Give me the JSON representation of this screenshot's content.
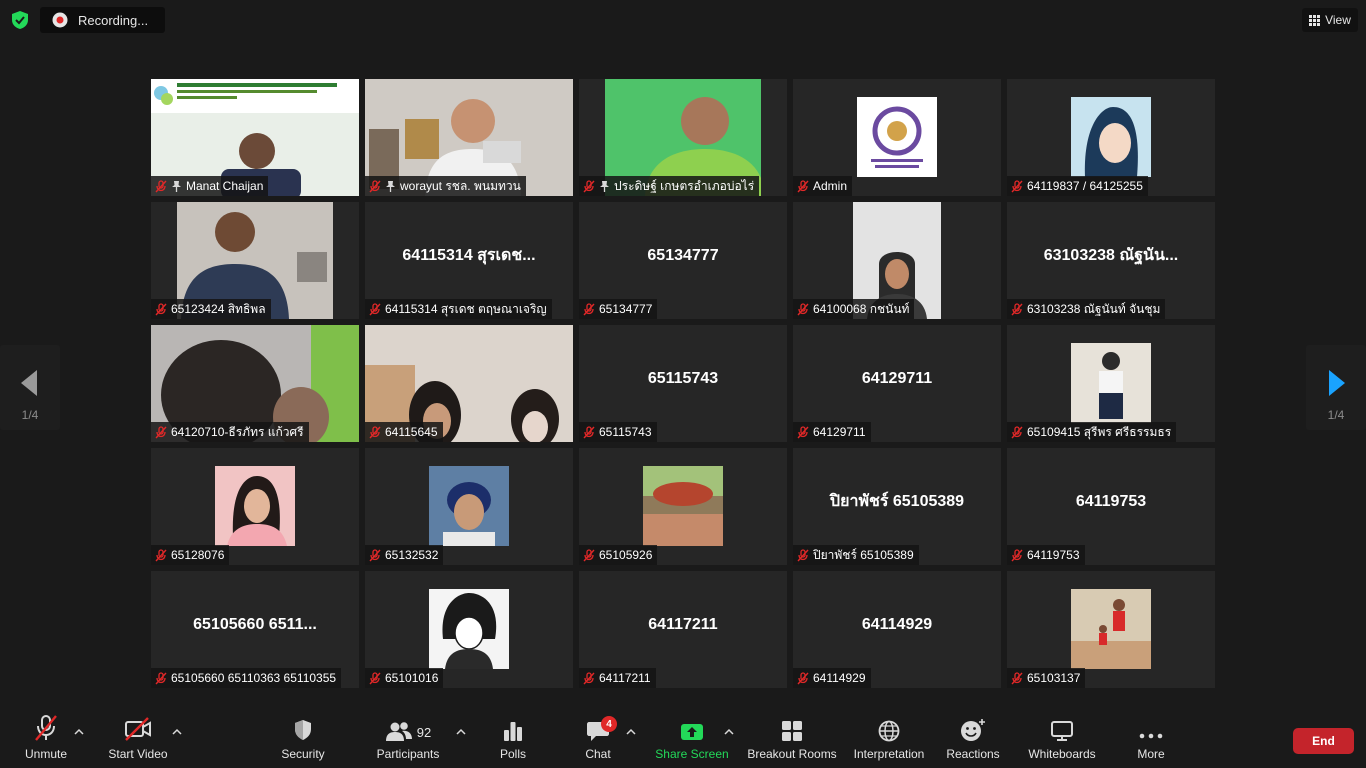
{
  "topbar": {
    "recording_label": "Recording...",
    "view_label": "View"
  },
  "pager": {
    "left_page": "1/4",
    "right_page": "1/4"
  },
  "colors": {
    "active_border": "#e7ea7a",
    "end_button": "#c4242b",
    "share_green": "#23d959",
    "badge_red": "#e02828"
  },
  "tiles": [
    {
      "label": "Manat Chaijan",
      "pinned": true,
      "video": "conference-presenter"
    },
    {
      "label": "worayut รชล. พนมทวน",
      "pinned": true,
      "active": true,
      "video": "office-speaker"
    },
    {
      "label": "ประดิษฐ์ เกษตรอำเภอบ่อไร่",
      "pinned": true,
      "video": "green-wall-speaker"
    },
    {
      "label": "Admin",
      "video": "university-logo"
    },
    {
      "label": "64119837 / 64125255",
      "video": "anime-avatar"
    },
    {
      "label": "65123424 สิทธิพล",
      "video": "student-room"
    },
    {
      "label": "64115314 สุรเดช ตฤษณาเจริญ",
      "big": "64115314 สุรเดช..."
    },
    {
      "label": "65134777",
      "big": "65134777"
    },
    {
      "label": "64100068 กชนันท์",
      "video": "student-portrait"
    },
    {
      "label": "63103238 ณัฐนันท์ จันชุม",
      "big": "63103238 ณัฐนัน..."
    },
    {
      "label": "64120710-ธีรภัทร แก้วศรี",
      "video": "blurry-closeup"
    },
    {
      "label": "64115645",
      "video": "two-students"
    },
    {
      "label": "65115743",
      "big": "65115743"
    },
    {
      "label": "64129711",
      "big": "64129711"
    },
    {
      "label": "65109415 สุรีพร ศรีธรรมธร",
      "video": "uniform-photo"
    },
    {
      "label": "65128076",
      "video": "girl-photo"
    },
    {
      "label": "65132532",
      "video": "boy-photo"
    },
    {
      "label": "65105926",
      "video": "outdoor-photo"
    },
    {
      "label": "ปิยาพัชร์ 65105389",
      "big": "ปิยาพัชร์ 65105389"
    },
    {
      "label": "64119753",
      "big": "64119753"
    },
    {
      "label": "65105660 65110363 65110355",
      "big": "65105660 6511..."
    },
    {
      "label": "65101016",
      "video": "manga-avatar"
    },
    {
      "label": "64117211",
      "big": "64117211"
    },
    {
      "label": "64114929",
      "big": "64114929"
    },
    {
      "label": "65103137",
      "video": "running-photo"
    }
  ],
  "toolbar": {
    "unmute": "Unmute",
    "start_video": "Start Video",
    "security": "Security",
    "participants": "Participants",
    "participants_count": "92",
    "polls": "Polls",
    "chat": "Chat",
    "chat_badge": "4",
    "share_screen": "Share Screen",
    "breakout_rooms": "Breakout Rooms",
    "interpretation": "Interpretation",
    "reactions": "Reactions",
    "whiteboards": "Whiteboards",
    "more": "More",
    "end": "End"
  }
}
